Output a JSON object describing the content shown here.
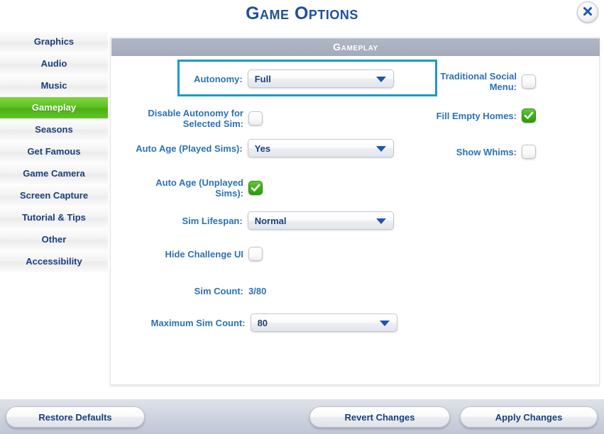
{
  "window": {
    "title": "Game Options",
    "close_icon": "close-icon"
  },
  "sidebar": {
    "items": [
      {
        "label": "Graphics",
        "selected": false
      },
      {
        "label": "Audio",
        "selected": false
      },
      {
        "label": "Music",
        "selected": false
      },
      {
        "label": "Gameplay",
        "selected": true
      },
      {
        "label": "Seasons",
        "selected": false
      },
      {
        "label": "Get Famous",
        "selected": false
      },
      {
        "label": "Game Camera",
        "selected": false
      },
      {
        "label": "Screen Capture",
        "selected": false
      },
      {
        "label": "Tutorial & Tips",
        "selected": false
      },
      {
        "label": "Other",
        "selected": false
      },
      {
        "label": "Accessibility",
        "selected": false
      }
    ]
  },
  "panel": {
    "header": "Gameplay",
    "options": {
      "autonomy": {
        "label": "Autonomy:",
        "value": "Full",
        "control": "dropdown",
        "highlighted": true
      },
      "disable_autonomy": {
        "label": "Disable Autonomy for Selected Sim:",
        "value": "off",
        "control": "checkbox"
      },
      "auto_age_played": {
        "label": "Auto Age (Played Sims):",
        "value": "Yes",
        "control": "dropdown"
      },
      "auto_age_unplayed": {
        "label": "Auto Age (Unplayed Sims):",
        "value": "on",
        "control": "checkbox"
      },
      "sim_lifespan": {
        "label": "Sim Lifespan:",
        "value": "Normal",
        "control": "dropdown"
      },
      "hide_challenge_ui": {
        "label": "Hide Challenge UI",
        "value": "off",
        "control": "checkbox"
      },
      "sim_count": {
        "label": "Sim Count:",
        "value": "3/80",
        "control": "text"
      },
      "maximum_sim_count": {
        "label": "Maximum Sim Count:",
        "value": "80",
        "control": "dropdown"
      },
      "traditional_social": {
        "label": "Traditional Social Menu:",
        "value": "off",
        "control": "checkbox"
      },
      "fill_empty_homes": {
        "label": "Fill Empty Homes:",
        "value": "on",
        "control": "checkbox"
      },
      "show_whims": {
        "label": "Show Whims:",
        "value": "off",
        "control": "checkbox"
      }
    }
  },
  "footer": {
    "restore_defaults": "Restore Defaults",
    "revert_changes": "Revert Changes",
    "apply_changes": "Apply Changes"
  },
  "colors": {
    "title_blue": "#1f4f9c",
    "label_blue": "#2c71b8",
    "selected_green": "#4cb115",
    "highlight_teal": "#1b9bc4",
    "header_gray": "#a4abbb"
  }
}
